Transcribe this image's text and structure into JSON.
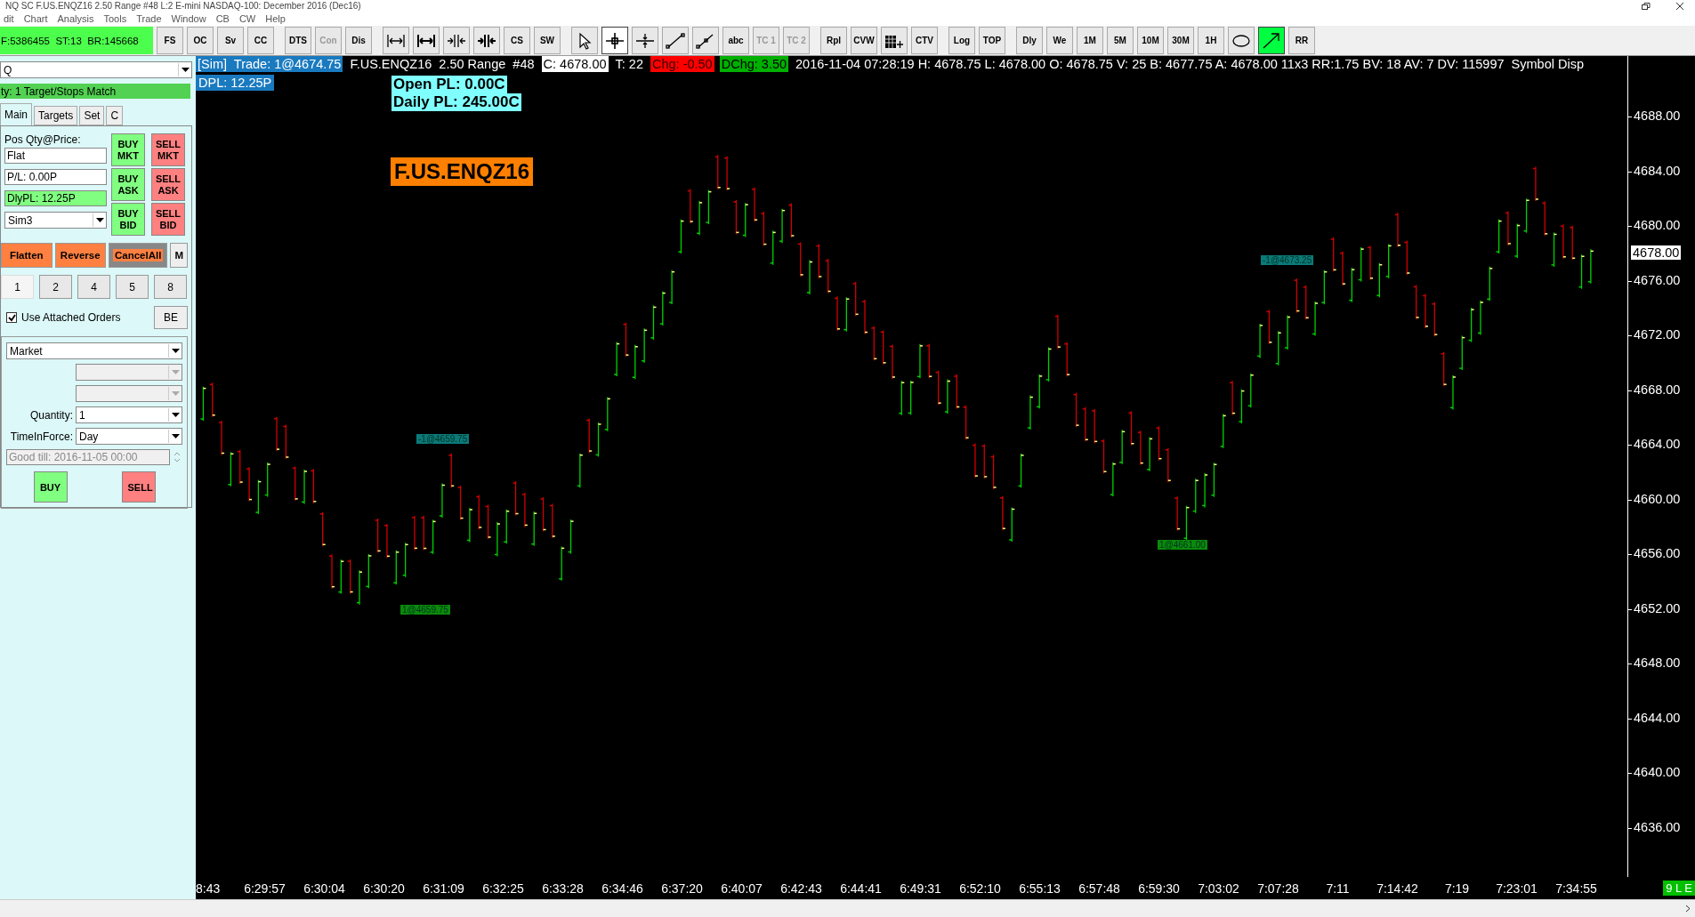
{
  "window": {
    "title": "NQ  SC F.US.ENQZ16  2.50 Range  #48  L:2  E-mini NASDAQ-100: December 2016 (Dec16)"
  },
  "menu": [
    "dit",
    "Chart",
    "Analysis",
    "Tools",
    "Trade",
    "Window",
    "CB",
    "CW",
    "Help"
  ],
  "toolbar": {
    "status": "F:5386455  ST:13  BR:145668",
    "items": [
      {
        "kind": "text",
        "label": "FS",
        "disabled": false
      },
      {
        "kind": "text",
        "label": "OC",
        "disabled": false
      },
      {
        "kind": "text",
        "label": "Sv",
        "disabled": false
      },
      {
        "kind": "text",
        "label": "CC",
        "disabled": false
      },
      {
        "kind": "separator"
      },
      {
        "kind": "text",
        "label": "DTS",
        "disabled": false
      },
      {
        "kind": "text",
        "label": "Con",
        "disabled": true
      },
      {
        "kind": "text",
        "label": "Dis",
        "disabled": false
      },
      {
        "kind": "separator"
      },
      {
        "kind": "icon",
        "selected": false
      },
      {
        "kind": "icon",
        "selected": false
      },
      {
        "kind": "icon",
        "selected": false
      },
      {
        "kind": "icon",
        "selected": false
      },
      {
        "kind": "text",
        "label": "CS",
        "disabled": false
      },
      {
        "kind": "text",
        "label": "SW",
        "disabled": false
      },
      {
        "kind": "separator"
      },
      {
        "kind": "icon",
        "selected": false
      },
      {
        "kind": "icon",
        "selected": true
      },
      {
        "kind": "icon",
        "selected": false
      },
      {
        "kind": "icon",
        "selected": false
      },
      {
        "kind": "icon",
        "selected": false
      },
      {
        "kind": "text",
        "label": "abc",
        "disabled": false
      },
      {
        "kind": "text",
        "label": "TC 1",
        "disabled": true
      },
      {
        "kind": "text",
        "label": "TC 2",
        "disabled": true
      },
      {
        "kind": "separator"
      },
      {
        "kind": "text",
        "label": "Rpl",
        "disabled": false
      },
      {
        "kind": "text",
        "label": "CVW",
        "disabled": false
      },
      {
        "kind": "icon",
        "selected": false
      },
      {
        "kind": "text",
        "label": "CTV",
        "disabled": false
      },
      {
        "kind": "separator"
      },
      {
        "kind": "text",
        "label": "Log",
        "disabled": false
      },
      {
        "kind": "text",
        "label": "TOP",
        "disabled": false
      },
      {
        "kind": "separator"
      },
      {
        "kind": "text",
        "label": "Dly",
        "disabled": false
      },
      {
        "kind": "text",
        "label": "We",
        "disabled": false
      },
      {
        "kind": "text",
        "label": "1M",
        "disabled": false
      },
      {
        "kind": "text",
        "label": "5M",
        "disabled": false
      },
      {
        "kind": "text",
        "label": "10M",
        "disabled": false
      },
      {
        "kind": "text",
        "label": "30M",
        "disabled": false
      },
      {
        "kind": "text",
        "label": "1H",
        "disabled": false
      },
      {
        "kind": "icon",
        "selected": false
      },
      {
        "kind": "icon",
        "selected": true,
        "color": "#00ff40"
      },
      {
        "kind": "text",
        "label": "RR",
        "disabled": false
      }
    ]
  },
  "order_panel": {
    "symbol": "Q",
    "match_status": "ty: 1 Target/Stops Match",
    "tabs": [
      {
        "label": "Main",
        "selected": true
      },
      {
        "label": "Targets",
        "selected": false
      },
      {
        "label": "Set",
        "selected": false
      },
      {
        "label": "C",
        "selected": false
      }
    ],
    "position_label": "Pos Qty@Price:",
    "position": "Flat",
    "pl": "P/L: 0.00P",
    "daily_pl": "DlyPL: 12.25P",
    "account": "Sim3",
    "quick_buttons": [
      {
        "label": "BUY MKT",
        "kind": "buy"
      },
      {
        "label": "SELL MKT",
        "kind": "sell"
      },
      {
        "label": "BUY ASK",
        "kind": "buy"
      },
      {
        "label": "SELL ASK",
        "kind": "sell"
      },
      {
        "label": "BUY BID",
        "kind": "buy"
      },
      {
        "label": "SELL BID",
        "kind": "sell"
      }
    ],
    "actions": [
      {
        "label": "Flatten",
        "kind": "orange"
      },
      {
        "label": "Reverse",
        "kind": "orange"
      },
      {
        "label": "CancelAll",
        "kind": "cancel"
      },
      {
        "label": "M",
        "kind": "plain"
      }
    ],
    "sizes": [
      {
        "label": "1",
        "selected": true
      },
      {
        "label": "2",
        "selected": false
      },
      {
        "label": "4",
        "selected": false
      },
      {
        "label": "5",
        "selected": false
      },
      {
        "label": "8",
        "selected": false
      }
    ],
    "attached_orders": {
      "label": "Use Attached Orders",
      "checked": true
    },
    "be_button": "BE",
    "order_type": "Market",
    "extra_selects": [
      {
        "disabled": true
      },
      {
        "disabled": true
      }
    ],
    "quantity": {
      "label": "Quantity:",
      "value": "1"
    },
    "time_in_force": {
      "label": "TimeInForce:",
      "value": "Day"
    },
    "good_till": {
      "value": "Good till: 2016-11-05 00:00",
      "disabled": true
    },
    "buy": "BUY",
    "sell": "SELL"
  },
  "chart": {
    "header": [
      {
        "text": "[Sim]  Trade: 1@4674.75",
        "kind": "sim"
      },
      {
        "text": "F.US.ENQZ16  2.50 Range  #48",
        "kind": "plain"
      },
      {
        "text": "C: 4678.00",
        "kind": "current"
      },
      {
        "text": "T: 22",
        "kind": "plain"
      },
      {
        "text": "Chg: -0.50",
        "kind": "down"
      },
      {
        "text": "DChg: 3.50",
        "kind": "up"
      },
      {
        "text": "2016-11-04 07:28:19 H: 4678.75 L: 4678.00 O: 4678.75 V: 25 B: 4677.75 A: 4678.00 11x3 RR:1.75 BV: 18 AV: 7 DV: 115997  Symbol Disp",
        "kind": "plain"
      }
    ],
    "dpl": "DPL: 12.25P",
    "open_pl": "Open PL: 0.00C",
    "daily_pl": "Daily PL: 245.00C",
    "symbol": "F.US.ENQZ16",
    "annotations": [
      {
        "text": "-1@4659.75",
        "kind": "sell"
      },
      {
        "text": "1@4659.75",
        "kind": "buy"
      },
      {
        "text": "-1@4673.25",
        "kind": "sell"
      },
      {
        "text": "1@4661.00",
        "kind": "buy"
      }
    ],
    "price_labels": [
      "4688.00",
      "4684.00",
      "4680.00",
      "4676.00",
      "4672.00",
      "4668.00",
      "4664.00",
      "4660.00",
      "4656.00",
      "4652.00",
      "4648.00",
      "4644.00",
      "4640.00",
      "4636.00"
    ],
    "current_price": "4678.00",
    "time_labels": [
      "8:43",
      "6:29:57",
      "6:30:04",
      "6:30:20",
      "6:31:09",
      "6:32:25",
      "6:33:28",
      "6:34:46",
      "6:37:20",
      "6:40:07",
      "6:42:43",
      "6:44:41",
      "6:49:31",
      "6:52:10",
      "6:55:13",
      "6:57:48",
      "6:59:30",
      "7:03:02",
      "7:07:28",
      "7:11",
      "7:14:42",
      "7:19",
      "7:23:01",
      "7:34:55"
    ],
    "status_badge": "9 L E"
  }
}
